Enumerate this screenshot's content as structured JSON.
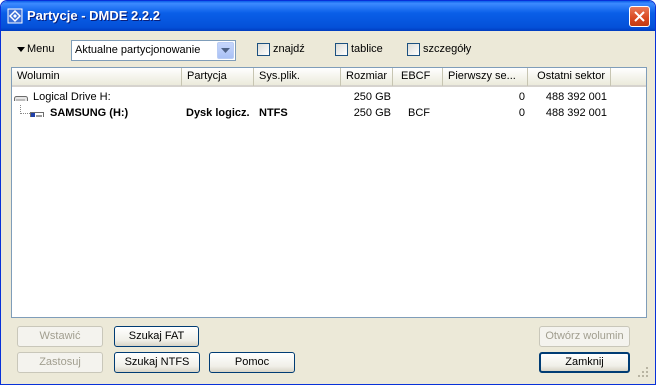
{
  "window": {
    "title": "Partycje - DMDE 2.2.2"
  },
  "toolbar": {
    "menu_label": "Menu",
    "partition_select_value": "Aktualne partycjonowanie",
    "checkboxes": [
      {
        "label": "znajdź",
        "checked": false
      },
      {
        "label": "tablice",
        "checked": false
      },
      {
        "label": "szczegóły",
        "checked": false
      }
    ]
  },
  "table": {
    "columns": [
      "Wolumin",
      "Partycja",
      "Sys.plik.",
      "Rozmiar",
      "EBCF",
      "Pierwszy se...",
      "Ostatni sektor"
    ],
    "rows": [
      {
        "wolumin": "Logical Drive H:",
        "partycja": "",
        "sys": "",
        "rozmiar": "250 GB",
        "ebcf": "",
        "pierwszy": "0",
        "ostatni": "488 392 001",
        "icon": "hdd-icon",
        "bold": false
      },
      {
        "wolumin": "SAMSUNG (H:)",
        "partycja": "Dysk logicz.",
        "sys": "NTFS",
        "rozmiar": "250 GB",
        "ebcf": "BCF",
        "pierwszy": "0",
        "ostatni": "488 392 001",
        "icon": "partition-icon",
        "bold": true
      }
    ]
  },
  "buttons": {
    "insert": "Wstawić",
    "apply": "Zastosuj",
    "find_fat": "Szukaj FAT",
    "find_ntfs": "Szukaj NTFS",
    "help": "Pomoc",
    "open_volume": "Otwórz wolumin",
    "close": "Zamknij"
  },
  "colors": {
    "titlebar": "#0a5fe8",
    "face": "#ece9d8",
    "border": "#7f9db9"
  }
}
